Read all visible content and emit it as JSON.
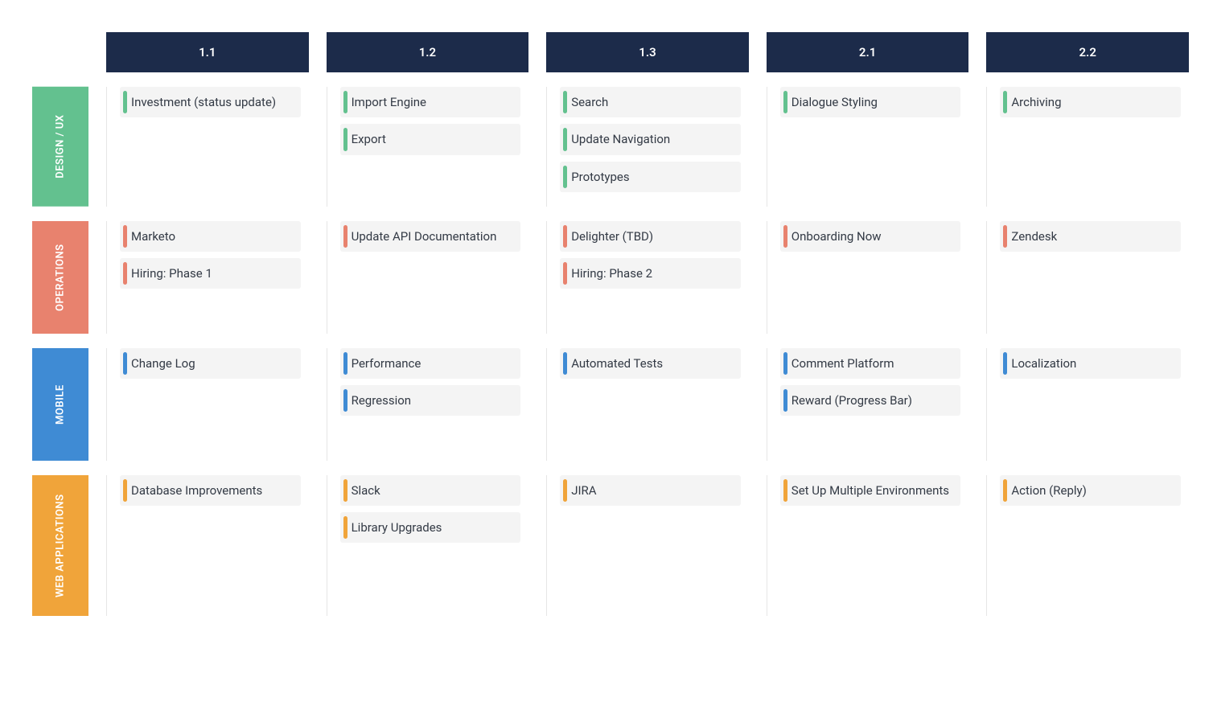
{
  "columns": [
    "1.1",
    "1.2",
    "1.3",
    "2.1",
    "2.2"
  ],
  "rows": [
    {
      "label": "DESIGN / UX",
      "color": "green",
      "cells": [
        [
          "Investment (status update)"
        ],
        [
          "Import Engine",
          "Export"
        ],
        [
          "Search",
          "Update Navigation",
          "Prototypes"
        ],
        [
          "Dialogue Styling"
        ],
        [
          "Archiving"
        ]
      ]
    },
    {
      "label": "OPERATIONS",
      "color": "red",
      "cells": [
        [
          "Marketo",
          "Hiring: Phase 1"
        ],
        [
          "Update API Documentation"
        ],
        [
          "Delighter (TBD)",
          "Hiring: Phase 2"
        ],
        [
          "Onboarding Now"
        ],
        [
          "Zendesk"
        ]
      ]
    },
    {
      "label": "MOBILE",
      "color": "blue",
      "cells": [
        [
          "Change Log"
        ],
        [
          "Performance",
          "Regression"
        ],
        [
          "Automated Tests"
        ],
        [
          "Comment Platform",
          "Reward (Progress Bar)"
        ],
        [
          "Localization"
        ]
      ]
    },
    {
      "label": "WEB APPLICATIONS",
      "color": "orange",
      "cells": [
        [
          "Database Improvements"
        ],
        [
          "Slack",
          "Library Upgrades"
        ],
        [
          "JIRA"
        ],
        [
          "Set Up Multiple Environments"
        ],
        [
          "Action (Reply)"
        ]
      ]
    }
  ]
}
